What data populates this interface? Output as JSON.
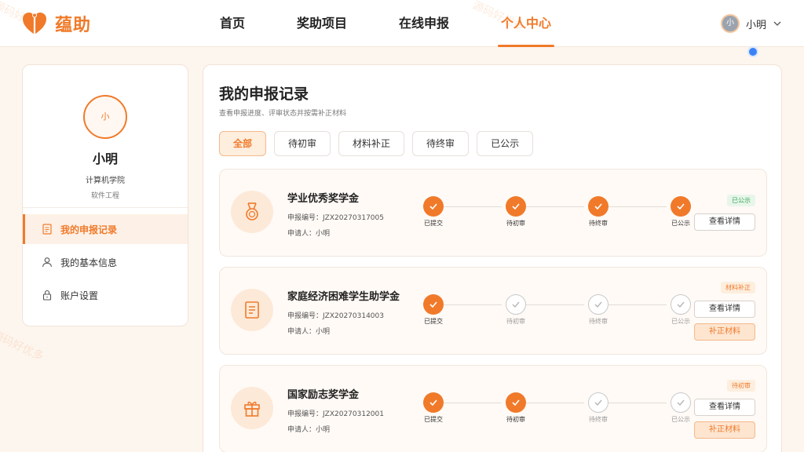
{
  "brand": {
    "name": "蕴助"
  },
  "nav": [
    {
      "label": "首页",
      "active": false
    },
    {
      "label": "奖助项目",
      "active": false
    },
    {
      "label": "在线申报",
      "active": false
    },
    {
      "label": "个人中心",
      "active": true
    }
  ],
  "user": {
    "avatar_text": "小",
    "name": "小明"
  },
  "watermark": "源码好优多",
  "profile": {
    "avatar_text": "小",
    "name": "小明",
    "college": "计算机学院",
    "major": "软件工程"
  },
  "side_menu": [
    {
      "label": "我的申报记录",
      "icon": "document-icon",
      "active": true
    },
    {
      "label": "我的基本信息",
      "icon": "user-icon",
      "active": false
    },
    {
      "label": "账户设置",
      "icon": "lock-icon",
      "active": false
    }
  ],
  "main": {
    "title": "我的申报记录",
    "subtitle": "查看申报进度、评审状态并按需补正材料"
  },
  "filters": [
    {
      "label": "全部",
      "active": true
    },
    {
      "label": "待初审",
      "active": false
    },
    {
      "label": "材料补正",
      "active": false
    },
    {
      "label": "待终审",
      "active": false
    },
    {
      "label": "已公示",
      "active": false
    }
  ],
  "step_labels": [
    "已提交",
    "待初审",
    "待终审",
    "已公示"
  ],
  "records": [
    {
      "title": "学业优秀奖学金",
      "number_label": "申报编号：",
      "number": "JZX20270317005",
      "applicant_label": "申请人：",
      "applicant": "小明",
      "icon": "medal-icon",
      "steps_done": [
        true,
        true,
        true,
        true
      ],
      "status": "已公示",
      "status_color": "green",
      "detail_label": "查看详情",
      "supplement_label": ""
    },
    {
      "title": "家庭经济困难学生助学金",
      "number_label": "申报编号：",
      "number": "JZX20270314003",
      "applicant_label": "申请人：",
      "applicant": "小明",
      "icon": "form-icon",
      "steps_done": [
        true,
        false,
        false,
        false
      ],
      "status": "材料补正",
      "status_color": "orange",
      "detail_label": "查看详情",
      "supplement_label": "补正材料"
    },
    {
      "title": "国家励志奖学金",
      "number_label": "申报编号：",
      "number": "JZX20270312001",
      "applicant_label": "申请人：",
      "applicant": "小明",
      "icon": "gift-icon",
      "steps_done": [
        true,
        true,
        false,
        false
      ],
      "status": "待初审",
      "status_color": "orange",
      "detail_label": "查看详情",
      "supplement_label": "补正材料"
    }
  ],
  "colors": {
    "accent": "#f07a2a",
    "green": "#3aa55a"
  }
}
